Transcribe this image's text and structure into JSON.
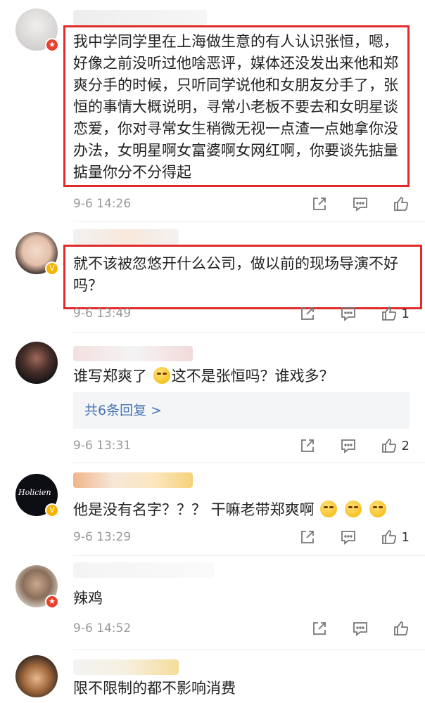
{
  "colors": {
    "highlight": "#e12b2b",
    "link": "#4a76b4",
    "meta": "#999999"
  },
  "icons": {
    "repost": "share-icon",
    "comment": "comment-icon",
    "like": "thumbs-up-icon"
  },
  "comments": [
    {
      "text": "我中学同学里在上海做生意的有人认识张恒，嗯，好像之前没听过他啥恶评，媒体还没发出来他和郑爽分手的时候，只听同学说他和女朋友分手了，张恒的事情大概说明，寻常小老板不要去和女明星谈恋爱，你对寻常女生稍微无视一点渣一点她拿你没办法，女明星啊女富婆啊女网红啊，你要谈先掂量掂量你分不分得起",
      "time": "9-6 14:26",
      "likes": "",
      "badge": "★"
    },
    {
      "text": "就不该被忽悠开什么公司，做以前的现场导演不好吗？",
      "time": "9-6 13:49",
      "likes": "1",
      "badge": "V"
    },
    {
      "text_a": "谁写郑爽了",
      "text_b": "这不是张恒吗？谁戏多？",
      "replies": "共6条回复 >",
      "time": "9-6 13:31",
      "likes": "2"
    },
    {
      "text": "他是没有名字？？？ 干嘛老带郑爽啊",
      "time": "9-6 13:29",
      "likes": "1",
      "badge": "V",
      "avatar_text": "Holicien"
    },
    {
      "text": "辣鸡",
      "time": "9-6 14:52",
      "likes": "",
      "badge": "★"
    },
    {
      "text": "限不限制的都不影响消费"
    }
  ]
}
